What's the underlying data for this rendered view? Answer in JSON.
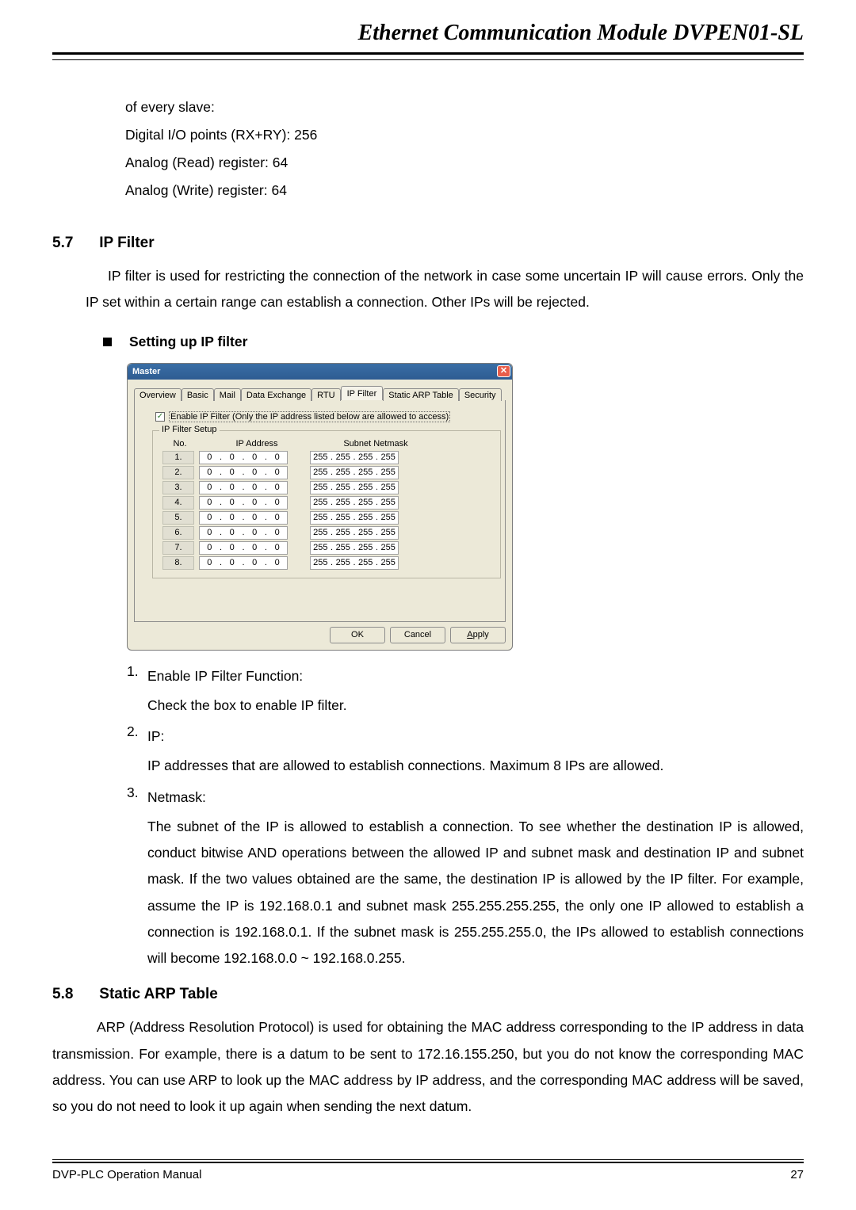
{
  "header": {
    "title": "Ethernet Communication Module DVPEN01-SL"
  },
  "intro_block": {
    "l1": "of every slave:",
    "l2": "Digital I/O points (RX+RY): 256",
    "l3": "Analog (Read) register: 64",
    "l4": "Analog (Write) register: 64"
  },
  "sec57": {
    "num": "5.7",
    "title": "IP Filter",
    "para": "IP filter is used for restricting the connection of the network in case some uncertain IP will cause errors. Only the IP set within a certain range can establish a connection. Other IPs will be rejected.",
    "bullet": "Setting up IP filter"
  },
  "dialog": {
    "title": "Master",
    "tabs": {
      "t0": "Overview",
      "t1": "Basic",
      "t2": "Mail",
      "t3": "Data Exchange",
      "t4": "RTU",
      "t5": "IP Filter",
      "t6": "Static ARP Table",
      "t7": "Security"
    },
    "enable_label": "Enable IP Filter  (Only the IP address listed below are allowed to access)",
    "group_title": "IP Filter Setup",
    "col_no": "No.",
    "col_ip": "IP Address",
    "col_sn": "Subnet Netmask",
    "rows": [
      {
        "no": "1.",
        "ip": [
          "0",
          "0",
          "0",
          "0"
        ],
        "sn": [
          "255",
          "255",
          "255",
          "255"
        ]
      },
      {
        "no": "2.",
        "ip": [
          "0",
          "0",
          "0",
          "0"
        ],
        "sn": [
          "255",
          "255",
          "255",
          "255"
        ]
      },
      {
        "no": "3.",
        "ip": [
          "0",
          "0",
          "0",
          "0"
        ],
        "sn": [
          "255",
          "255",
          "255",
          "255"
        ]
      },
      {
        "no": "4.",
        "ip": [
          "0",
          "0",
          "0",
          "0"
        ],
        "sn": [
          "255",
          "255",
          "255",
          "255"
        ]
      },
      {
        "no": "5.",
        "ip": [
          "0",
          "0",
          "0",
          "0"
        ],
        "sn": [
          "255",
          "255",
          "255",
          "255"
        ]
      },
      {
        "no": "6.",
        "ip": [
          "0",
          "0",
          "0",
          "0"
        ],
        "sn": [
          "255",
          "255",
          "255",
          "255"
        ]
      },
      {
        "no": "7.",
        "ip": [
          "0",
          "0",
          "0",
          "0"
        ],
        "sn": [
          "255",
          "255",
          "255",
          "255"
        ]
      },
      {
        "no": "8.",
        "ip": [
          "0",
          "0",
          "0",
          "0"
        ],
        "sn": [
          "255",
          "255",
          "255",
          "255"
        ]
      }
    ],
    "buttons": {
      "ok": "OK",
      "cancel": "Cancel",
      "apply": "Apply"
    },
    "checkmark": "✓",
    "close": "✕"
  },
  "list": {
    "i1_n": "1.",
    "i1_t": "Enable IP Filter Function:",
    "i1_s": "Check the box to enable IP filter.",
    "i2_n": "2.",
    "i2_t": "IP:",
    "i2_s": "IP addresses that are allowed to establish connections. Maximum 8 IPs are allowed.",
    "i3_n": "3.",
    "i3_t": "Netmask:",
    "i3_s": "The subnet of the IP is allowed to establish a connection. To see whether the destination IP is allowed, conduct bitwise AND operations between the allowed IP and subnet mask and destination IP and subnet mask. If the two values obtained are the same, the destination IP is allowed by the IP filter. For example, assume the IP is 192.168.0.1 and subnet mask 255.255.255.255, the only one IP allowed to establish a connection is 192.168.0.1. If the subnet mask is 255.255.255.0, the IPs allowed to establish connections will become 192.168.0.0 ~ 192.168.0.255."
  },
  "sec58": {
    "num": "5.8",
    "title": "Static ARP Table",
    "para": "ARP (Address Resolution Protocol) is used for obtaining the MAC address corresponding to the IP address in data transmission. For example, there is a datum to be sent to 172.16.155.250, but you do not know the corresponding MAC address. You can use ARP to look up the MAC address by IP address, and the corresponding MAC address will be saved, so you do not need to look it up again when sending the next datum."
  },
  "footer": {
    "left": "DVP-PLC Operation Manual",
    "right": "27"
  }
}
